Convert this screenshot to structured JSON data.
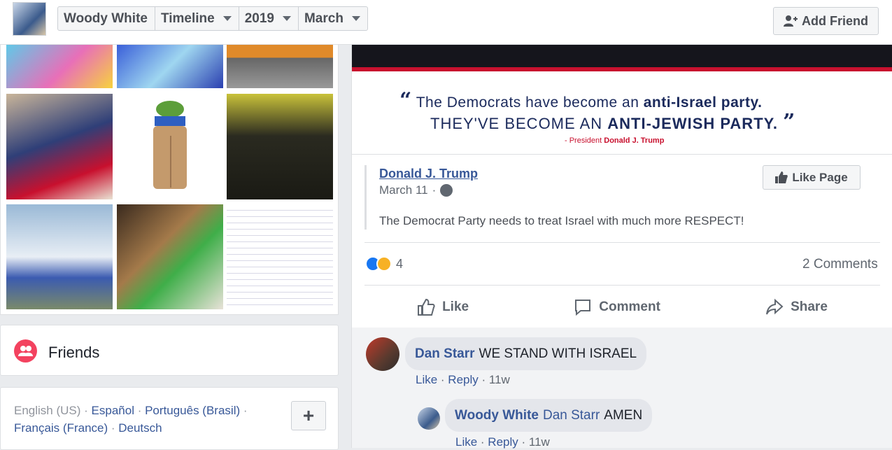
{
  "header": {
    "profile_name": "Woody White",
    "section": "Timeline",
    "year": "2019",
    "month": "March",
    "add_friend": "Add Friend"
  },
  "sidebar": {
    "friends_label": "Friends",
    "languages": {
      "current": "English (US)",
      "options": [
        "Español",
        "Português (Brasil)",
        "Français (France)",
        "Deutsch"
      ]
    },
    "more_button": "+"
  },
  "post": {
    "quote_line1_plain": "The Democrats have become an ",
    "quote_line1_bold": "anti-Israel party.",
    "quote_line2_plain": "THEY'VE BECOME AN ",
    "quote_line2_bold": "ANTI-JEWISH PARTY.",
    "attribution_prefix": "- President ",
    "attribution_name": "Donald J. Trump",
    "shared": {
      "author": "Donald J. Trump",
      "date": "March 11",
      "like_page": "Like Page",
      "text": "The Democrat Party needs to treat Israel with much more RESPECT!"
    },
    "reaction_count": "4",
    "comments_count": "2 Comments",
    "actions": {
      "like": "Like",
      "comment": "Comment",
      "share": "Share"
    }
  },
  "comments": [
    {
      "author": "Dan Starr",
      "text": "WE STAND WITH ISRAEL",
      "like": "Like",
      "reply": "Reply",
      "age": "11w"
    },
    {
      "author": "Woody White",
      "tag": "Dan Starr",
      "text": "AMEN",
      "like": "Like",
      "reply": "Reply",
      "age": "11w"
    }
  ],
  "colors": {
    "link": "#385898",
    "background": "#e9ebee",
    "quote_navy": "#1b2a5c",
    "accent_red": "#c8102e"
  }
}
